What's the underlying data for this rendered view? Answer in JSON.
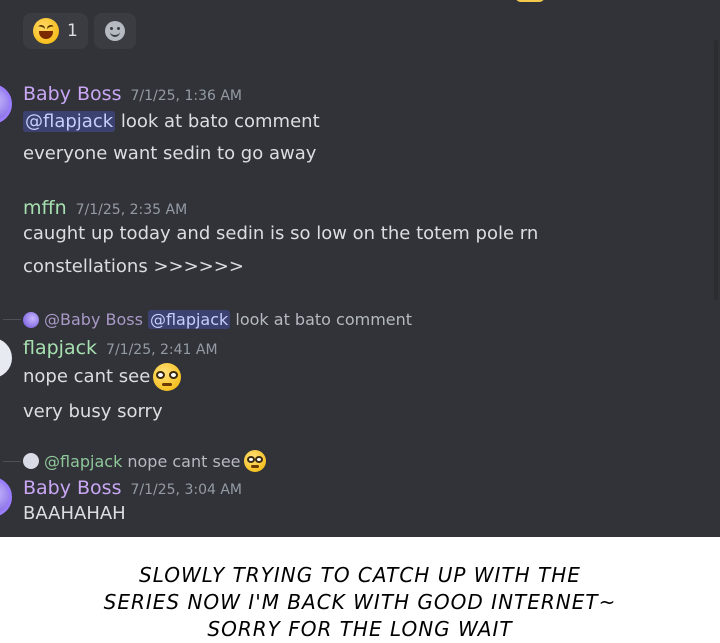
{
  "reactions": [
    {
      "icon": "laughing-emoji-icon",
      "count": "1"
    },
    {
      "icon": "add-reaction-icon"
    }
  ],
  "messages": [
    {
      "author": "Baby Boss",
      "timestamp": "7/1/25, 1:36 AM",
      "lines": [
        {
          "mention": "@flapjack",
          "text": " look at bato comment"
        },
        {
          "text": "everyone want sedin to go away"
        }
      ]
    },
    {
      "author": "mffn",
      "timestamp": "7/1/25, 2:35 AM",
      "lines": [
        {
          "text": "caught up today and sedin is so low on the totem pole rn"
        },
        {
          "text": "constellations >>>>>>"
        }
      ]
    },
    {
      "reply": {
        "name": "@Baby Boss",
        "mention": "@flapjack",
        "text": " look at bato comment"
      },
      "author": "flapjack",
      "timestamp": "7/1/25, 2:41 AM",
      "lines": [
        {
          "text": "nope cant see",
          "emoji": "nerd-face-emoji-icon"
        },
        {
          "text": "very busy sorry"
        }
      ]
    },
    {
      "reply": {
        "name": "@flapjack",
        "text": " nope cant see",
        "emoji": "nerd-face-emoji-icon"
      },
      "author": "Baby Boss",
      "timestamp": "7/1/25, 3:04 AM",
      "lines": [
        {
          "text": "BAAHAHAH"
        }
      ]
    }
  ],
  "caption": {
    "lines": [
      "SLOWLY TRYING TO CATCH UP WITH THE",
      "SERIES NOW I'M BACK WITH GOOD INTERNET~",
      "SORRY FOR THE LONG WAIT"
    ]
  },
  "colors": {
    "background": "#313338",
    "mention_bg": "#3c4270",
    "babyboss_name": "#c9a7f5",
    "green_name": "#a7e0b0"
  }
}
